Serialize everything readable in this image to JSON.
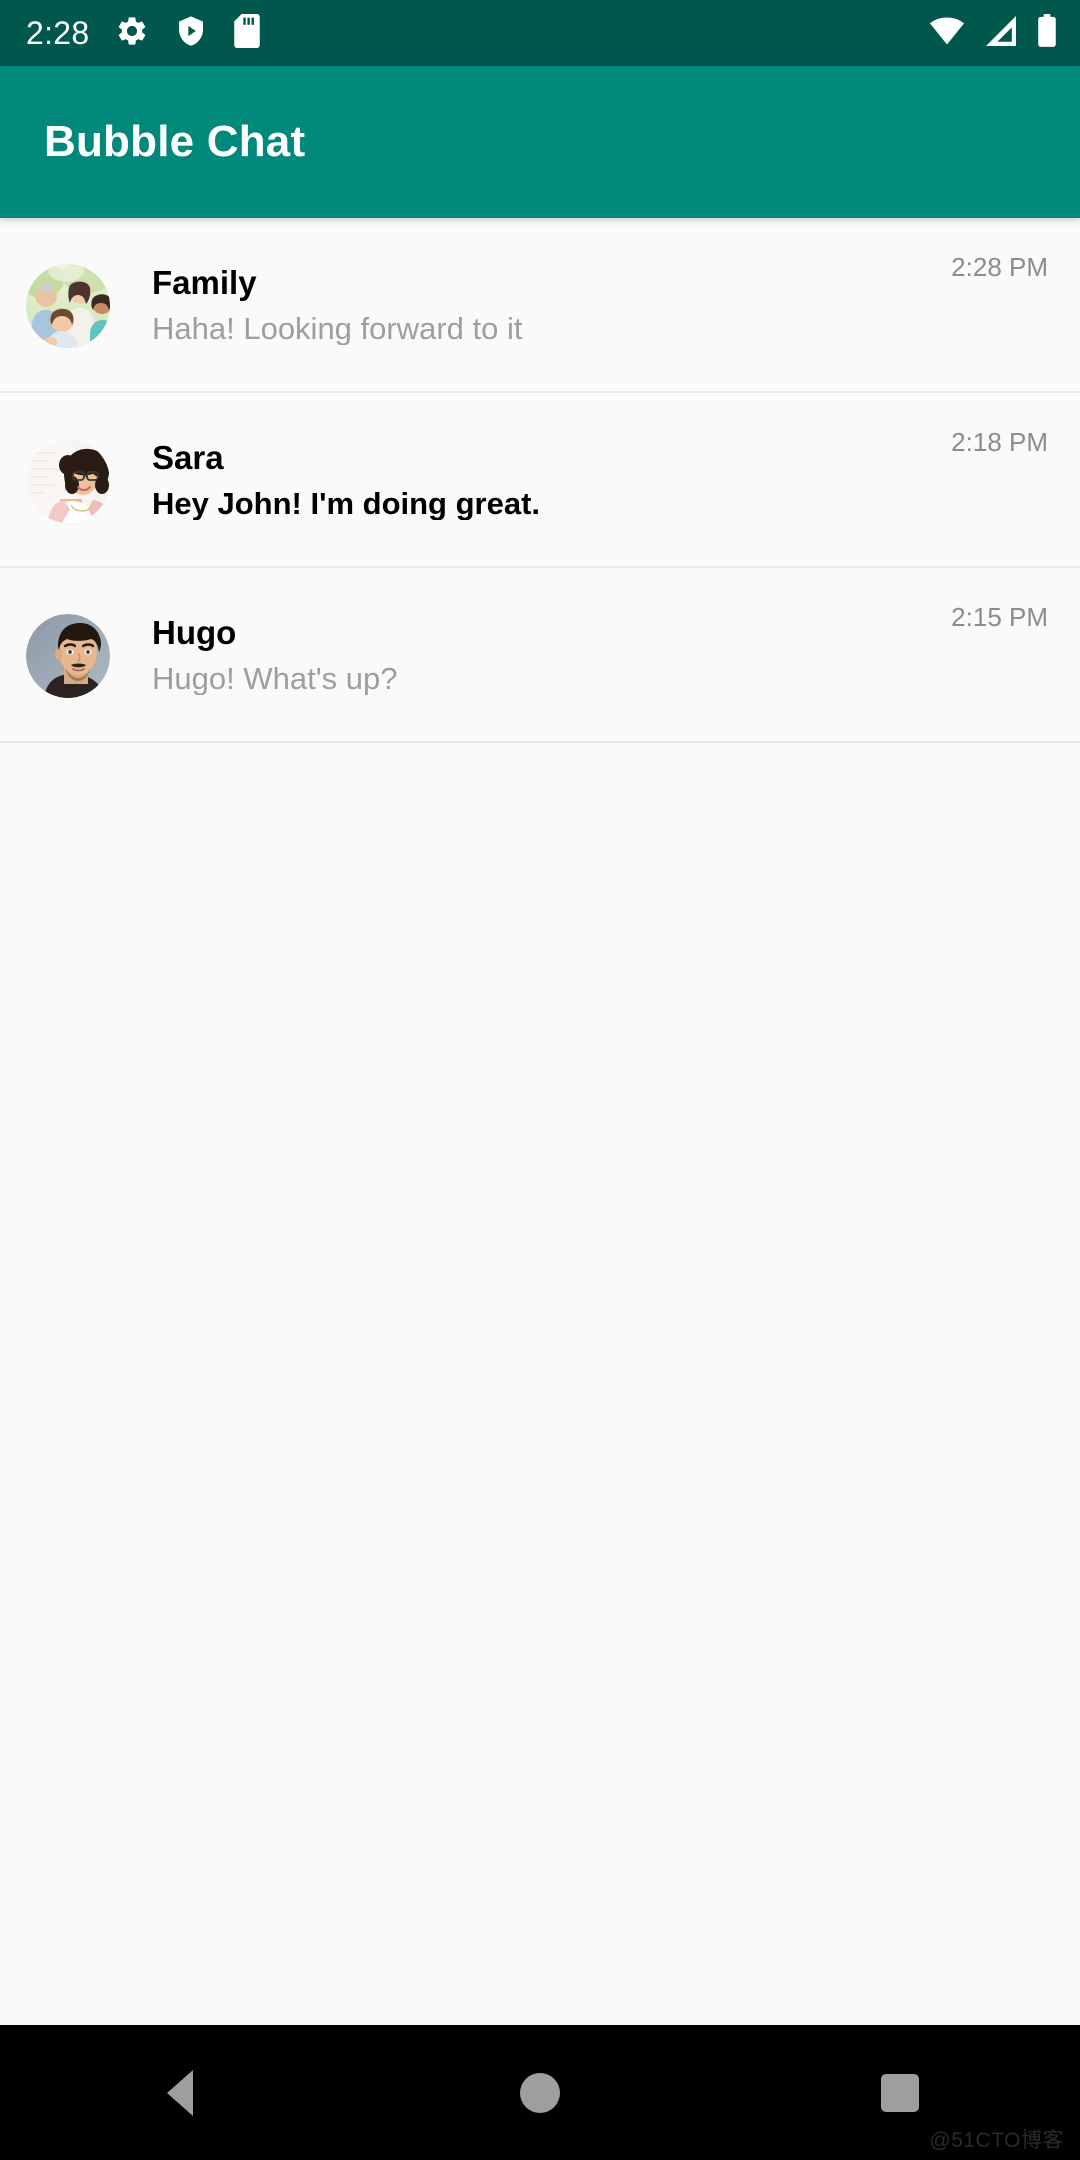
{
  "status_bar": {
    "time": "2:28",
    "left_icons": [
      "gear-icon",
      "play-protect-shield-icon",
      "sd-card-icon"
    ],
    "right_icons": [
      "wifi-icon",
      "cellular-signal-icon",
      "battery-icon"
    ],
    "background_color": "#00574C",
    "icon_color": "#FFFFFF"
  },
  "app_bar": {
    "title": "Bubble Chat",
    "background_color": "#00897B",
    "title_color": "#FFFFFF"
  },
  "chat_list": {
    "rows": [
      {
        "name": "Family",
        "preview": "Haha! Looking forward to it",
        "time": "2:28 PM",
        "unread": false,
        "avatar": "family-group-photo-avatar"
      },
      {
        "name": "Sara",
        "preview": "Hey John! I'm doing great.",
        "time": "2:18 PM",
        "unread": true,
        "avatar": "sara-portrait-avatar"
      },
      {
        "name": "Hugo",
        "preview": "Hugo! What's up?",
        "time": "2:15 PM",
        "unread": false,
        "avatar": "hugo-portrait-avatar"
      }
    ],
    "background_color": "#FAFAFA",
    "divider_color": "#E8E8E8",
    "preview_read_color": "#9E9E9E",
    "preview_unread_color": "#000000",
    "time_color": "#8C8C8C"
  },
  "nav_bar": {
    "buttons": [
      "back-button",
      "home-button",
      "recents-button"
    ],
    "background_color": "#000000",
    "icon_color": "#9E9E9E"
  },
  "watermark": {
    "text": "@51CTO博客"
  }
}
